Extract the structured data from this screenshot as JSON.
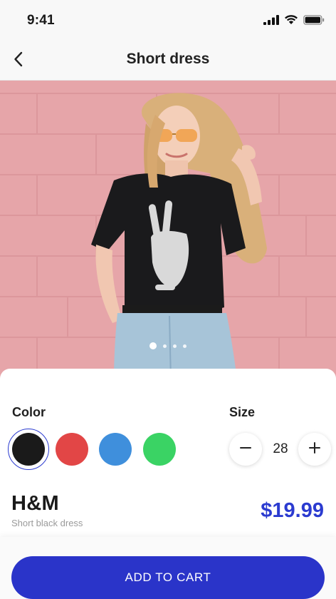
{
  "status_bar": {
    "time": "9:41"
  },
  "nav": {
    "title": "Short dress"
  },
  "gallery": {
    "dot_count": 4,
    "active_index": 0
  },
  "color": {
    "label": "Color",
    "swatches": [
      {
        "name": "black",
        "hex": "#1a1a1a",
        "selected": true
      },
      {
        "name": "red",
        "hex": "#e24646"
      },
      {
        "name": "blue",
        "hex": "#3f8fdc"
      },
      {
        "name": "green",
        "hex": "#3ad364"
      }
    ]
  },
  "size": {
    "label": "Size",
    "value": "28"
  },
  "product": {
    "brand": "H&M",
    "description": "Short black dress",
    "price": "$19.99"
  },
  "cart": {
    "button_label": "ADD TO CART"
  },
  "colors": {
    "accent": "#2b3bd0",
    "button": "#2a34c9"
  }
}
